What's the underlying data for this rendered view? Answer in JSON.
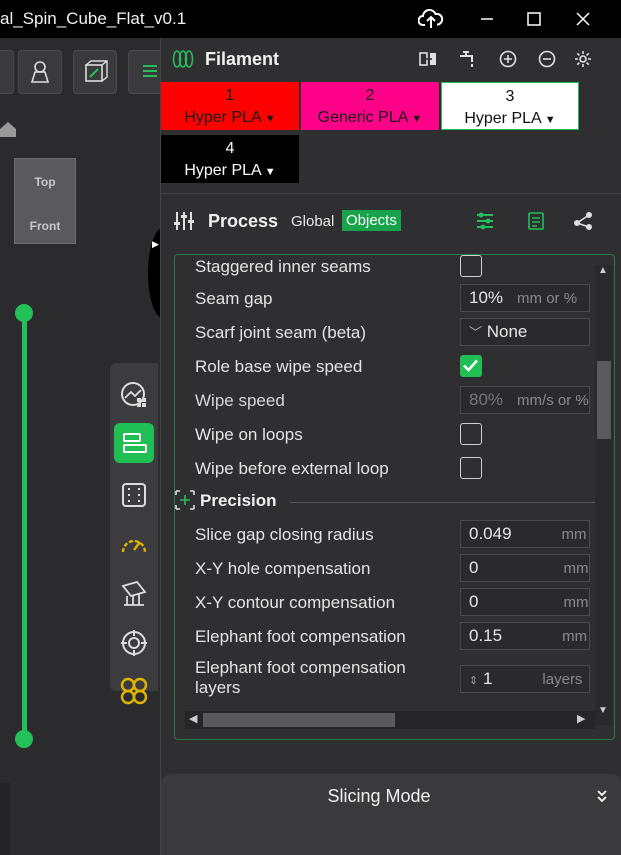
{
  "window": {
    "title": "al_Spin_Cube_Flat_v0.1",
    "buttons": [
      "cloud-upload-icon",
      "minimize-icon",
      "maximize-icon",
      "close-icon"
    ]
  },
  "viewport": {
    "cube_top": "Top",
    "cube_front": "Front"
  },
  "filament": {
    "title": "Filament",
    "slots": [
      {
        "number": "1",
        "name": "Hyper PLA",
        "color": "#ff0000",
        "text_color": "#1a1a1a"
      },
      {
        "number": "2",
        "name": "Generic PLA",
        "color": "#ff0088",
        "text_color": "#1a1a1a"
      },
      {
        "number": "3",
        "name": "Hyper PLA",
        "color": "#ffffff",
        "text_color": "#111111"
      },
      {
        "number": "4",
        "name": "Hyper PLA",
        "color": "#000000",
        "text_color": "#ffffff"
      }
    ]
  },
  "process": {
    "title": "Process",
    "tab_global": "Global",
    "tab_objects": "Objects"
  },
  "settings": {
    "partial_row": "Staggered inner seams",
    "seam_gap": {
      "label": "Seam gap",
      "value": "10%",
      "unit": "mm or %"
    },
    "scarf": {
      "label": "Scarf joint seam (beta)",
      "value": "None"
    },
    "role_wipe": {
      "label": "Role base wipe speed",
      "checked": true
    },
    "wipe_speed": {
      "label": "Wipe speed",
      "value": "80%",
      "unit": "mm/s or %"
    },
    "wipe_loops": {
      "label": "Wipe on loops",
      "checked": false
    },
    "wipe_ext": {
      "label": "Wipe before external loop",
      "checked": false
    },
    "precision_title": "Precision",
    "gap_radius": {
      "label": "Slice gap closing radius",
      "value": "0.049",
      "unit": "mm"
    },
    "xy_hole": {
      "label": "X-Y hole compensation",
      "value": "0",
      "unit": "mm"
    },
    "xy_contour": {
      "label": "X-Y contour compensation",
      "value": "0",
      "unit": "mm"
    },
    "elephant": {
      "label": "Elephant foot compensation",
      "value": "0.15",
      "unit": "mm"
    },
    "elephant_layers": {
      "label_line1": "Elephant foot compensation",
      "label_line2": "layers",
      "value": "1",
      "unit": "layers"
    }
  },
  "slicing": {
    "label": "Slicing Mode"
  },
  "colors": {
    "accent": "#1fbf56"
  }
}
